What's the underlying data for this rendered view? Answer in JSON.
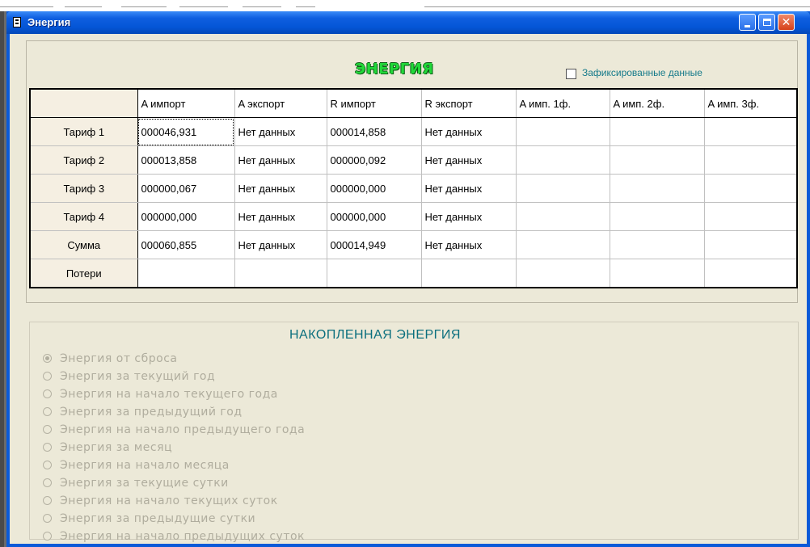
{
  "window": {
    "title": "Энергия",
    "minimize_label": "_",
    "maximize_label": "□",
    "close_label": "✕"
  },
  "icons": {
    "system_menu": "document-icon",
    "minimize": "minimize-icon",
    "maximize": "maximize-icon",
    "close": "close-icon",
    "checkbox": "checkbox-icon",
    "radio": "radio-icon"
  },
  "colors": {
    "titlebar": "#0455d6",
    "heading": "#22d83a",
    "accent_text": "#0b6f7e",
    "disabled_text": "#b0ad9e"
  },
  "energy": {
    "heading": "ЭНЕРГИЯ",
    "fixed_data_label": "Зафиксированные  данные",
    "fixed_data_checked": false,
    "columns": [
      "",
      "A импорт",
      "A экспорт",
      "R импорт",
      "R экспорт",
      "A имп. 1ф.",
      "A имп. 2ф.",
      "A имп. 3ф."
    ],
    "rows": [
      {
        "label": "Тариф 1",
        "cells": [
          "000046,931",
          "Нет данных",
          "000014,858",
          "Нет данных",
          "",
          "",
          ""
        ]
      },
      {
        "label": "Тариф 2",
        "cells": [
          "000013,858",
          "Нет данных",
          "000000,092",
          "Нет данных",
          "",
          "",
          ""
        ]
      },
      {
        "label": "Тариф 3",
        "cells": [
          "000000,067",
          "Нет данных",
          "000000,000",
          "Нет данных",
          "",
          "",
          ""
        ]
      },
      {
        "label": "Тариф 4",
        "cells": [
          "000000,000",
          "Нет данных",
          "000000,000",
          "Нет данных",
          "",
          "",
          ""
        ]
      },
      {
        "label": "Сумма",
        "cells": [
          "000060,855",
          "Нет данных",
          "000014,949",
          "Нет данных",
          "",
          "",
          ""
        ]
      },
      {
        "label": "Потери",
        "cells": [
          "",
          "",
          "",
          "",
          "",
          "",
          ""
        ]
      }
    ]
  },
  "accumulated": {
    "title": "НАКОПЛЕННАЯ ЭНЕРГИЯ",
    "options": [
      {
        "label": "Энергия от сброса",
        "checked": true
      },
      {
        "label": "Энергия за текущий год",
        "checked": false
      },
      {
        "label": "Энергия на начало текущего года",
        "checked": false
      },
      {
        "label": "Энергия за предыдущий год",
        "checked": false
      },
      {
        "label": "Энергия на начало предыдущего года",
        "checked": false
      },
      {
        "label": "Энергия за месяц",
        "checked": false
      },
      {
        "label": "Энергия на начало месяца",
        "checked": false
      },
      {
        "label": "Энергия за текущие сутки",
        "checked": false
      },
      {
        "label": "Энергия на начало текущих суток",
        "checked": false
      },
      {
        "label": "Энергия за предыдущие сутки",
        "checked": false
      },
      {
        "label": "Энергия на начало предыдущих суток",
        "checked": false
      }
    ]
  }
}
